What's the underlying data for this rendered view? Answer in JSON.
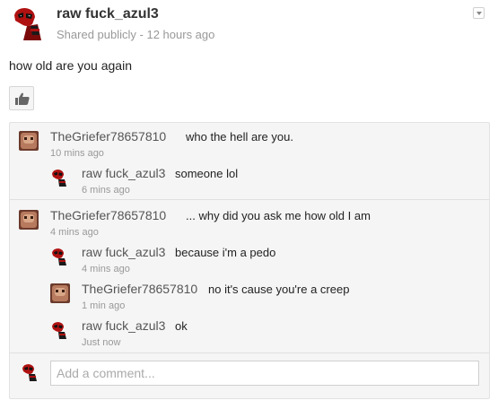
{
  "post": {
    "author": "raw fuck_azul3",
    "visibility": "Shared publicly",
    "separator": "-",
    "time": "12 hours ago",
    "text": "how old are you again",
    "avatar_icon": "deadpool-avatar-icon",
    "like_icon": "thumbs-up-icon"
  },
  "comments": [
    {
      "author": "TheGriefer78657810",
      "text": "who the hell are you.",
      "time": "10 mins ago"
    },
    {
      "author": "raw fuck_azul3",
      "text": "someone lol",
      "time": "6 mins ago"
    },
    {
      "author": "TheGriefer78657810",
      "text": "... why did you ask me how old I am",
      "time": "4 mins ago"
    },
    {
      "author": "raw fuck_azul3",
      "text": "because i'm a pedo",
      "time": "4 mins ago"
    },
    {
      "author": "TheGriefer78657810",
      "text": "no it's cause you're a creep",
      "time": "1 min ago"
    },
    {
      "author": "raw fuck_azul3",
      "text": "ok",
      "time": "Just now"
    }
  ],
  "add_comment": {
    "placeholder": "Add a comment..."
  },
  "colors": {
    "comments_bg": "#f5f5f5",
    "avatar_red": "#b01111"
  }
}
